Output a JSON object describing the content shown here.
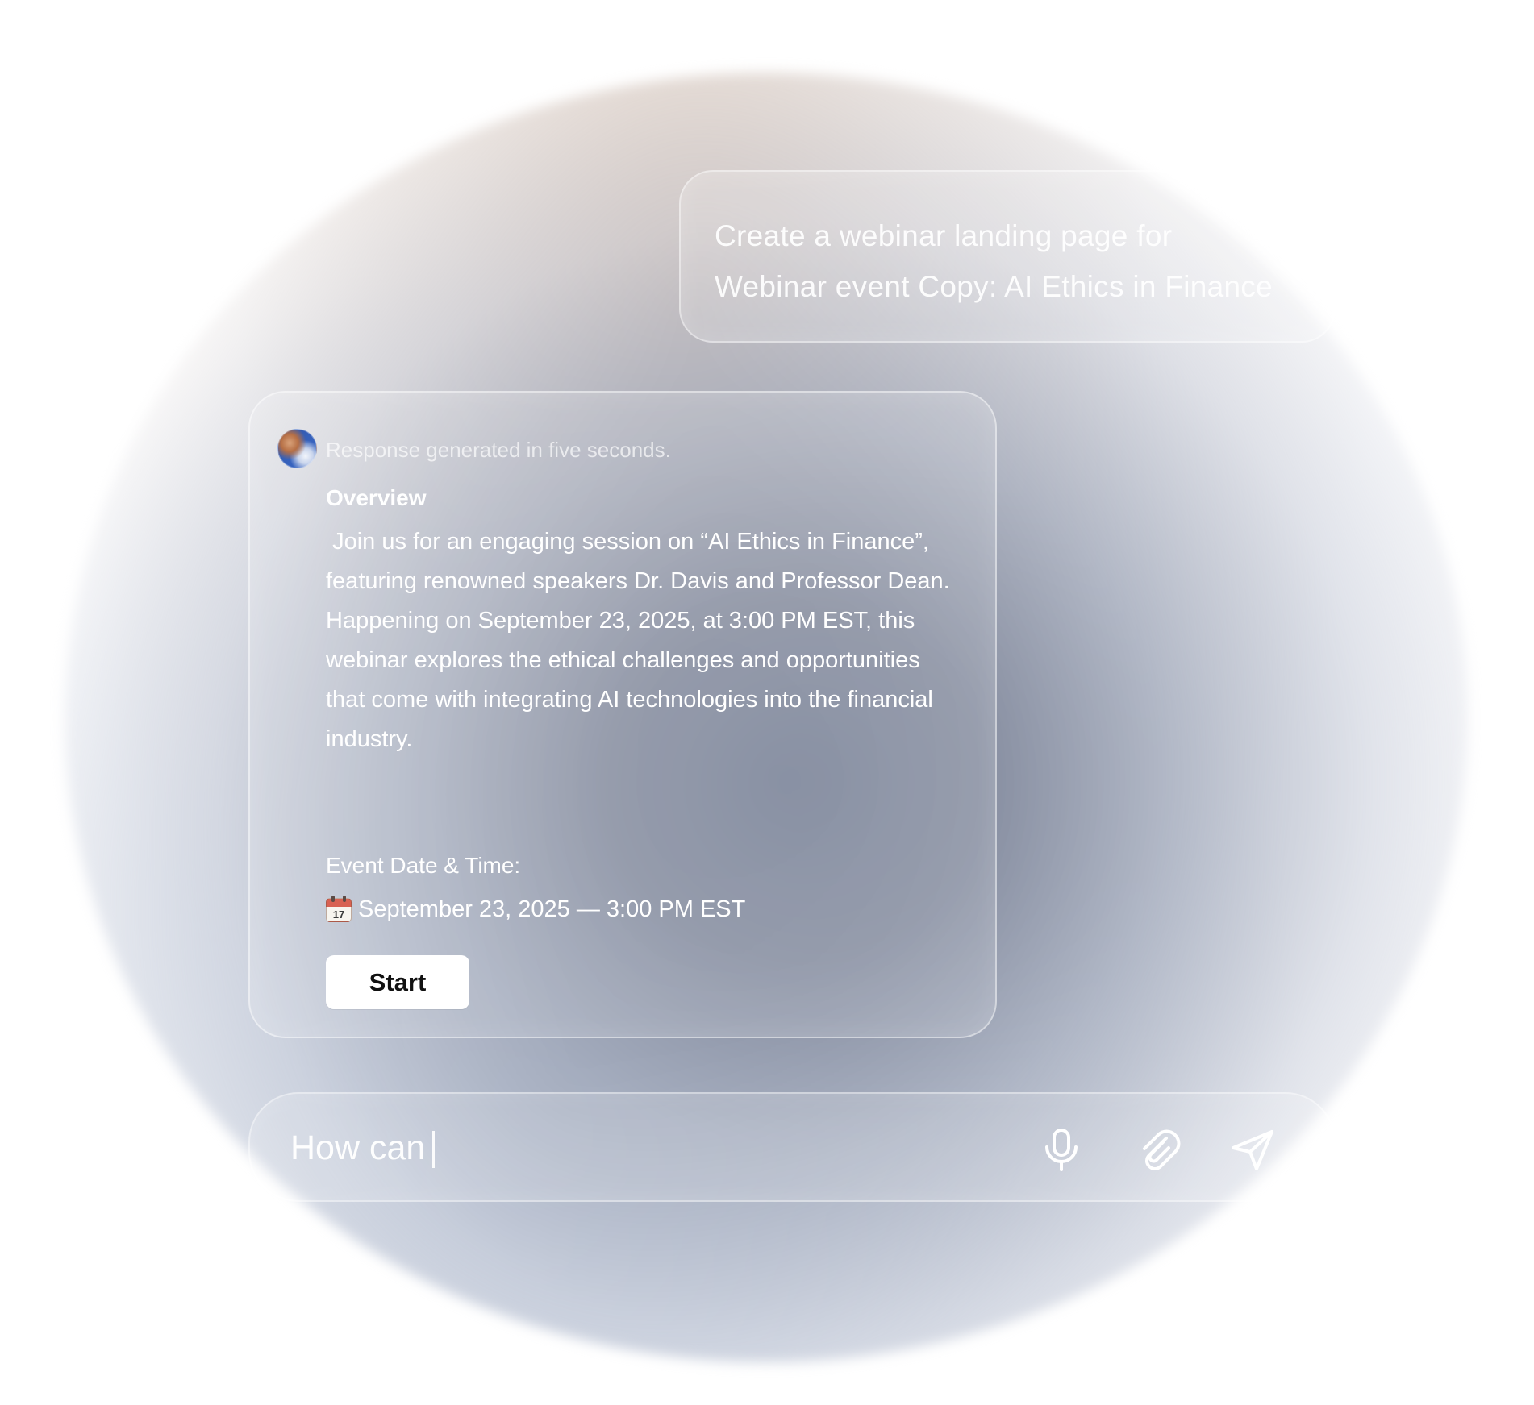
{
  "prompt": {
    "text": "Create a webinar landing page for\nWebinar event Copy: AI Ethics in Finance"
  },
  "response": {
    "meta": "Response generated in five seconds.",
    "overview_title": "Overview",
    "overview_body": " Join us for an engaging session on “AI Ethics in Finance”, featuring renowned speakers Dr. Davis and Professor Dean. Happening on September 23, 2025, at 3:00 PM EST, this webinar explores the ethical challenges and opportunities that come with integrating AI technologies into the financial industry.",
    "event_title": "Event Date & Time:",
    "event_value": "September 23, 2025 — 3:00 PM EST",
    "start_label": "Start"
  },
  "composer": {
    "value": "How can"
  },
  "icons": {
    "avatar": "avatar",
    "calendar": "calendar-icon",
    "microphone": "microphone-icon",
    "attachment": "paperclip-icon",
    "send": "send-icon"
  },
  "colors": {
    "button_background": "#ffffff",
    "button_text": "#111111",
    "text": "#ffffff"
  }
}
